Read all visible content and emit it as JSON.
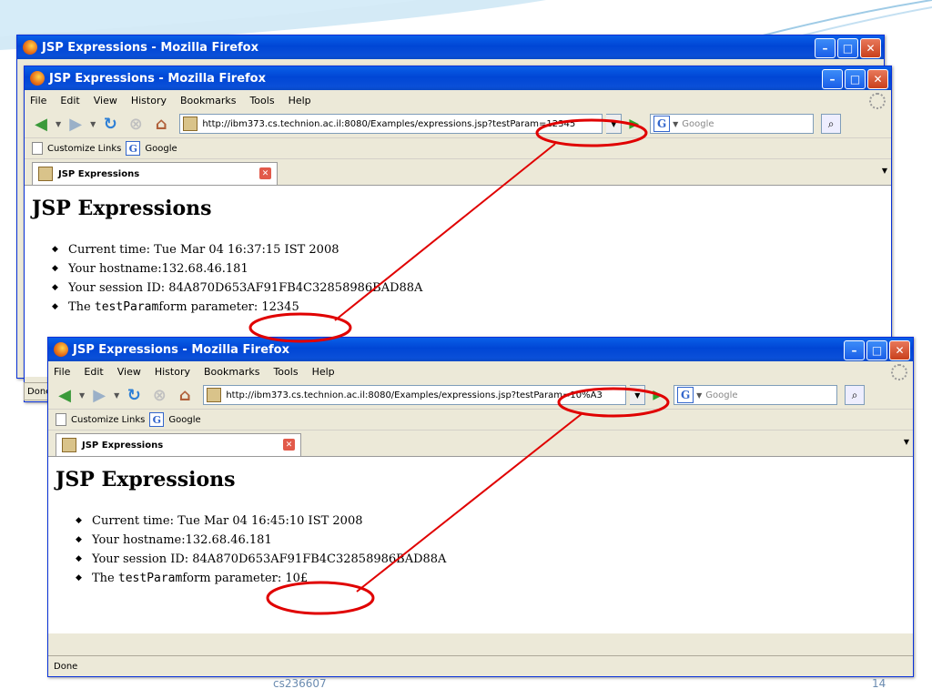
{
  "window": {
    "title": "JSP Expressions - Mozilla Firefox",
    "controls": [
      "minimize",
      "maximize",
      "close"
    ]
  },
  "menu": [
    "File",
    "Edit",
    "View",
    "History",
    "Bookmarks",
    "Tools",
    "Help"
  ],
  "search": {
    "placeholder": "Google"
  },
  "links_bar": {
    "customize": "Customize Links",
    "google": "Google"
  },
  "tab": {
    "title": "JSP Expressions"
  },
  "page": {
    "heading": "JSP Expressions",
    "param_name": "testParam"
  },
  "browser_1": {
    "url": "http://ibm373.cs.technion.ac.il:8080/Examples/expressions.jsp?testParam=12345",
    "time": "Current time: Tue Mar 04 16:37:15 IST 2008",
    "hostname": "Your hostname:132.68.46.181",
    "session": "Your session ID: 84A870D653AF91FB4C32858986BAD88A",
    "param_prefix": "The",
    "param_suffix": "form parameter: 12345",
    "status": "Done"
  },
  "browser_2": {
    "url": "http://ibm373.cs.technion.ac.il:8080/Examples/expressions.jsp?testParam=10%A3",
    "time": "Current time: Tue Mar 04 16:45:10 IST 2008",
    "hostname": "Your hostname:132.68.46.181",
    "session": "Your session ID: 84A870D653AF91FB4C32858986BAD88A",
    "param_prefix": "The",
    "param_suffix": "form parameter: 10£",
    "status": "Done"
  },
  "slide": {
    "footer_left": "cs236607",
    "page_number": "14"
  },
  "colors": {
    "annotation": "#e00000",
    "titlebar": "#0a5fe8"
  }
}
